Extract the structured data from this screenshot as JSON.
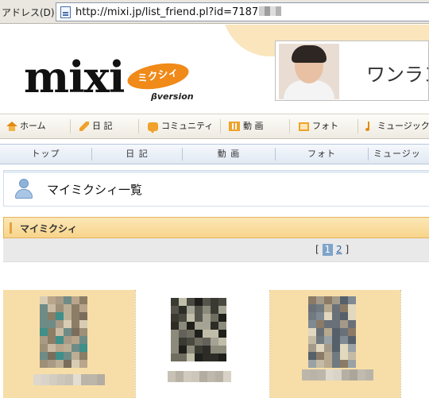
{
  "browser": {
    "address_label": "アドレス(D)",
    "url": "http://mixi.jp/list_friend.pl?id=7187"
  },
  "header": {
    "logo_text": "mixi",
    "logo_badge": "ミクシィ",
    "beta_label": "βversion",
    "banner_text": "ワンラン"
  },
  "global_nav": [
    {
      "label": "ホーム",
      "icon": "home-icon"
    },
    {
      "label": "日 記",
      "icon": "pencil-icon"
    },
    {
      "label": "コミュニティ",
      "icon": "speech-bubble-icon"
    },
    {
      "label": "動 画",
      "icon": "film-icon"
    },
    {
      "label": "フォト",
      "icon": "photo-icon"
    },
    {
      "label": "ミュージック",
      "icon": "music-note-icon"
    }
  ],
  "sub_nav": [
    "トップ",
    "日 記",
    "動 画",
    "フォト",
    "ミュージッ"
  ],
  "page": {
    "title": "マイミクシィ一覧",
    "section_title": "マイミクシィ",
    "pager": {
      "open": "[",
      "current": "1",
      "next": "2",
      "close": "]"
    }
  },
  "colors": {
    "accent_orange": "#f4a62a",
    "section_bg": "#f8d48a",
    "selected_cell": "#f7dea8",
    "nav_blue": "#e1e9f3",
    "pager_current": "#7fa4c9"
  },
  "friends": [
    {
      "highlighted": true,
      "photo": "pixelated-photo",
      "name": "pixelated-name"
    },
    {
      "highlighted": false,
      "photo": "pixelated-photo",
      "name": "pixelated-name"
    },
    {
      "highlighted": true,
      "photo": "pixelated-photo",
      "name": "pixelated-name"
    }
  ]
}
